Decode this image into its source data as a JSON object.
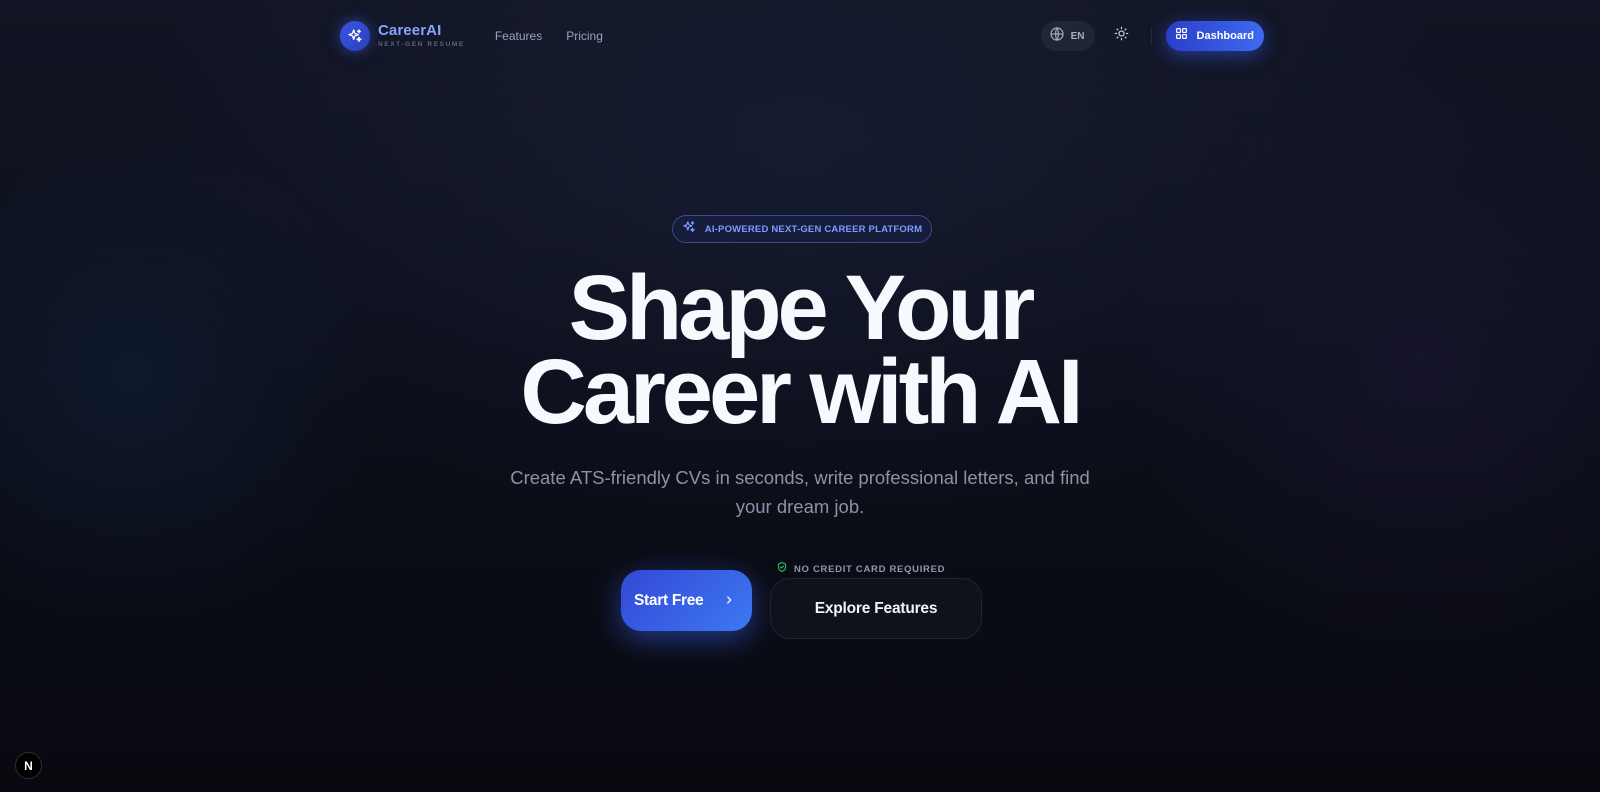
{
  "nav": {
    "logo_title": "CareerAI",
    "logo_subtitle": "NEXT-GEN RESUME",
    "links": [
      "Features",
      "Pricing"
    ],
    "language": "EN",
    "dashboard_label": "Dashboard"
  },
  "hero": {
    "pill_label": "AI-POWERED NEXT-GEN CAREER PLATFORM",
    "headline_line1": "Shape Your",
    "headline_line2": "Career with AI",
    "subtitle": "Create ATS-friendly CVs in seconds, write professional letters, and find your dream job.",
    "cta_primary": "Start Free",
    "cta_note": "NO CREDIT CARD REQUIRED",
    "cta_secondary": "Explore Features"
  },
  "dev_badge": "N",
  "icons": {
    "logo": "sparkles-icon",
    "language": "globe-icon",
    "theme": "sun-icon",
    "dashboard": "grid-icon",
    "pill": "sparkles-icon",
    "cta_primary": "chevron-right-icon",
    "cta_note": "shield-check-icon"
  },
  "colors": {
    "background": "#0a0c14",
    "accent": "#3d6bf0",
    "logo_text": "#8aa2ff",
    "pill_text": "#7d9bff",
    "note_icon": "#22c55e",
    "subtitle": "#8b93a6"
  }
}
